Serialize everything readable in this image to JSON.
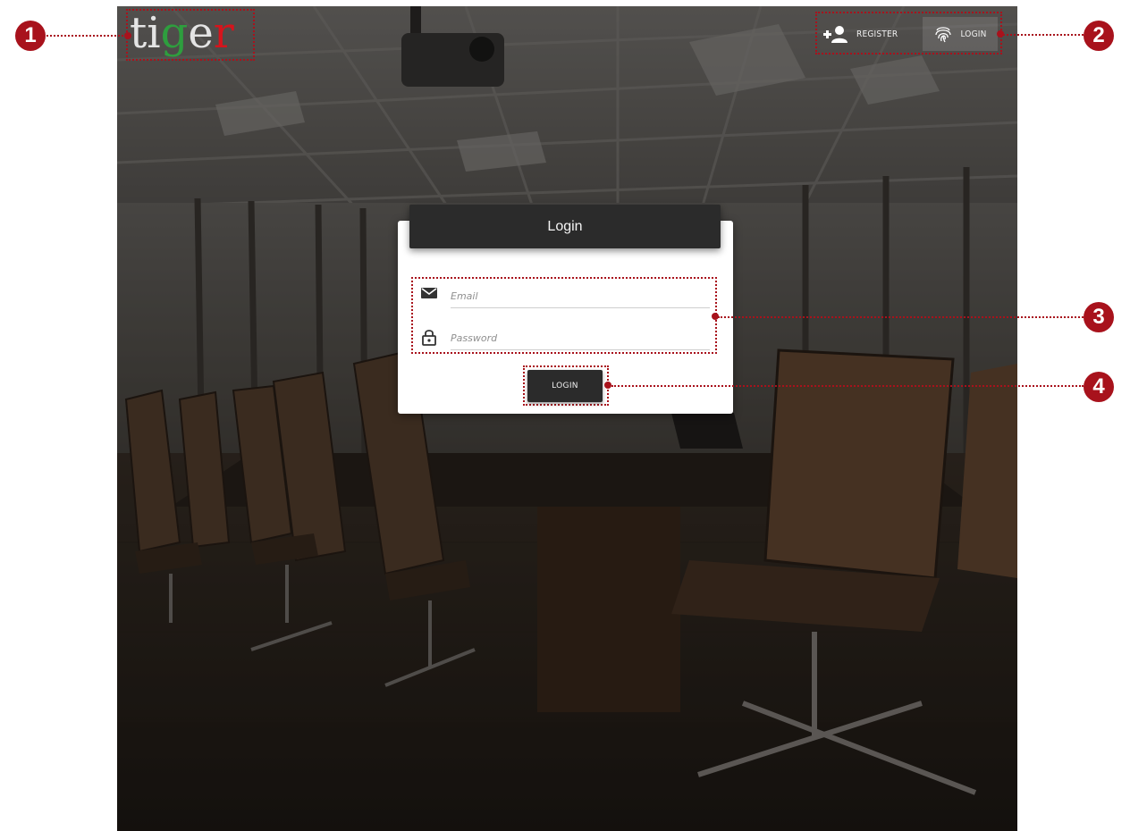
{
  "brand": {
    "logo_letters": [
      "t",
      "i",
      "g",
      "e",
      "r"
    ],
    "logo_colors": [
      "#e8e8e8",
      "#e8e8e8",
      "#2e9e3e",
      "#e8e8e8",
      "#d6141c"
    ]
  },
  "topnav": {
    "register_label": "REGISTER",
    "register_icon": "add-user-icon",
    "login_label": "LOGIN",
    "login_icon": "fingerprint-icon"
  },
  "login_form": {
    "title": "Login",
    "email": {
      "placeholder": "Email",
      "value": "",
      "icon": "mail-icon"
    },
    "password": {
      "placeholder": "Password",
      "value": "",
      "icon": "lock-icon"
    },
    "submit_label": "LOGIN"
  },
  "callouts": {
    "c1": "1",
    "c2": "2",
    "c3": "3",
    "c4": "4"
  },
  "colors": {
    "accent": "#a8121c",
    "header_bg": "#2b2b2b",
    "card_bg": "#ffffff"
  }
}
